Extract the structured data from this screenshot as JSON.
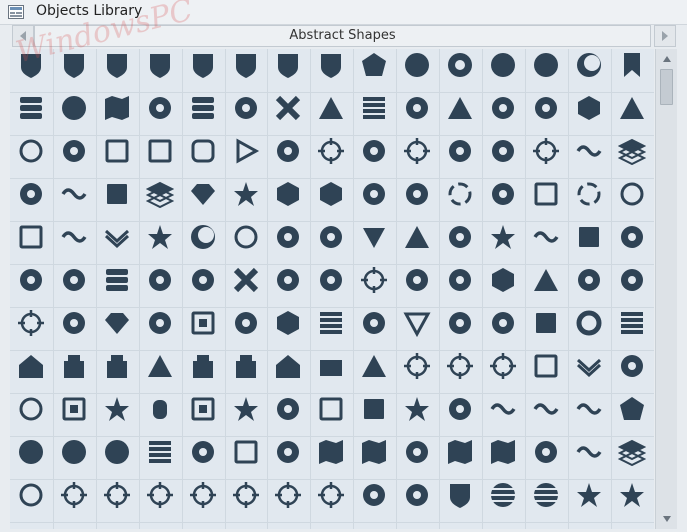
{
  "window": {
    "title": "Objects Library"
  },
  "category": {
    "name": "Abstract Shapes"
  },
  "watermark": {
    "text": "WindowsPC"
  },
  "colors": {
    "icon": "#2f4355",
    "grid_bg": "#e1e8ef",
    "title_bg": "#eef1f4"
  },
  "icons": [
    "shield-1",
    "shield-2",
    "shield-3",
    "shield-4",
    "shield-5",
    "shield-6",
    "shield-7",
    "shield-8",
    "pentagon-badge",
    "rounded-badge",
    "ring-badge",
    "flower-badge",
    "seal-badge",
    "crescent-circle",
    "bookmark",
    "stack-bars",
    "star-badge",
    "map-fold",
    "pinwheel",
    "database",
    "lock-circle",
    "x-mark",
    "pyramid-stripes",
    "grid-maze",
    "flower",
    "triangle-knot",
    "trefoil",
    "scallop-circle",
    "hexagon-cube",
    "drive-triangle",
    "ring",
    "play-outline",
    "square-outline",
    "square-thick",
    "rounded-square",
    "triangle-play",
    "crescent-spiral",
    "target-cross",
    "orbit-ring",
    "crosshair-circle",
    "swirl-link",
    "puzzle",
    "gear-crosshair",
    "s-curve",
    "layers",
    "eye-ring",
    "wave-line",
    "mountain-square",
    "stack-diamond",
    "diamond-gem",
    "starburst-rays",
    "magento-hex",
    "hex-s",
    "circle-arrow",
    "leaf-arc",
    "broken-ring",
    "check-arc",
    "square-brackets",
    "dashed-ring",
    "arc-circle",
    "square-frame",
    "zigzag-lines",
    "chevron-down-double",
    "dot-starburst",
    "crescent-moon",
    "octagon-ring",
    "swirl-shape",
    "plant-rays",
    "triangle-down",
    "triangle-knot-2",
    "knot-shape",
    "star-outline",
    "tilde-wave",
    "hourglass-square",
    "spiral-vortex",
    "spiral-circle",
    "swirl-ring",
    "bar-stack",
    "dotted-spiral",
    "tri-spin",
    "x-bold",
    "pie-circle",
    "circle-dots",
    "crosshair-bold",
    "wheel-spokes",
    "pac-circle",
    "rhombus-s",
    "triangle-swirl",
    "flag-f",
    "dotted-arrow",
    "crosshair-ring",
    "cogwheel-dots",
    "diamond-spin",
    "half-globe",
    "square-spiral",
    "cube-step",
    "hexagon-trio",
    "dot-grid",
    "dot-cluster",
    "triangle-outline",
    "jellyfish",
    "fan-rays",
    "square-slash",
    "ring-thick",
    "stripes-diagonal",
    "house",
    "tower",
    "castle",
    "triangle-solid",
    "bottle",
    "block-tower",
    "rounded-house",
    "slab",
    "triangle-slice",
    "crosshair-thin",
    "crosshair-dot",
    "crosshair-light",
    "bars-box",
    "double-chevron",
    "pinwheel-2",
    "dot-ring",
    "square-spiral-2",
    "star-burst",
    "cylinder",
    "nested-squares",
    "star-circle",
    "bar-slot",
    "slash-squares",
    "diagonal-box",
    "compass-star",
    "link-rings",
    "wave-lines",
    "u-turn",
    "m-wave",
    "pentagon-shield",
    "blob-badge",
    "scallop-badge",
    "crest-badge",
    "brick-wall",
    "wheel",
    "circle-square",
    "ring-dot",
    "map-fold-2",
    "map-fold-3",
    "network-nodes",
    "map-fold-4",
    "map-fold-5",
    "origami-bird",
    "tilde",
    "layers-2",
    "ring-outline",
    "target-thin",
    "crosshair-3",
    "crosshair-4",
    "crosshair-5",
    "crosshair-6",
    "crosshair-7",
    "bracket-ring",
    "sun-dot",
    "sun-rays",
    "shield-stripes",
    "striped-ball",
    "striped-ball-2",
    "star-bubble",
    "sparkle-star"
  ],
  "ui_icons": {
    "app": "objects-library-icon",
    "nav_left": "triangle-left-icon",
    "nav_right": "triangle-right-icon",
    "scroll_up": "scroll-up-icon",
    "scroll_down": "scroll-down-icon"
  }
}
